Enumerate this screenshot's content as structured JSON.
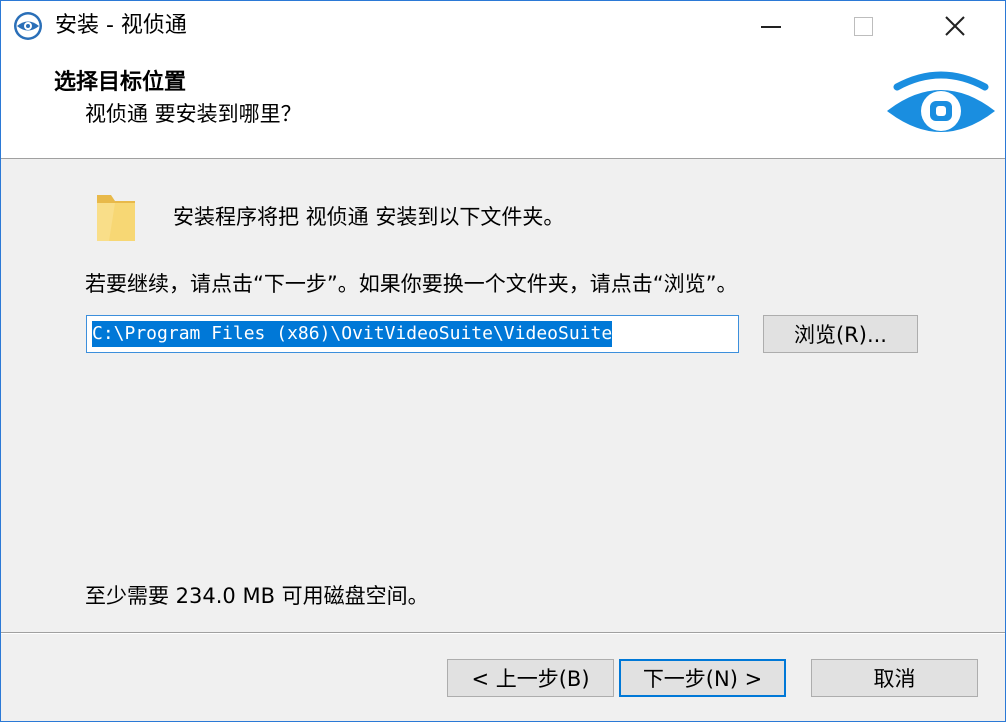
{
  "window": {
    "title": "安装 - 视侦通"
  },
  "header": {
    "title": "选择目标位置",
    "subtitle": "视侦通 要安装到哪里？"
  },
  "body": {
    "intro": "安装程序将把 视侦通 安装到以下文件夹。",
    "instruction": "若要继续，请点击“下一步”。如果你要换一个文件夹，请点击“浏览”。",
    "install_path": "C:\\Program Files (x86)\\OvitVideoSuite\\VideoSuite",
    "browse_label": "浏览(R)...",
    "disk_space": "至少需要 234.0 MB 可用磁盘空间。"
  },
  "footer": {
    "back_label": "< 上一步(B)",
    "next_label": "下一步(N) >",
    "cancel_label": "取消"
  },
  "colors": {
    "accent": "#0078d7",
    "logo_blue": "#1a8ee0",
    "folder_yellow": "#f7d774"
  },
  "icons": {
    "app": "eye-logo-icon",
    "header": "eye-logo-icon",
    "folder": "folder-icon"
  }
}
